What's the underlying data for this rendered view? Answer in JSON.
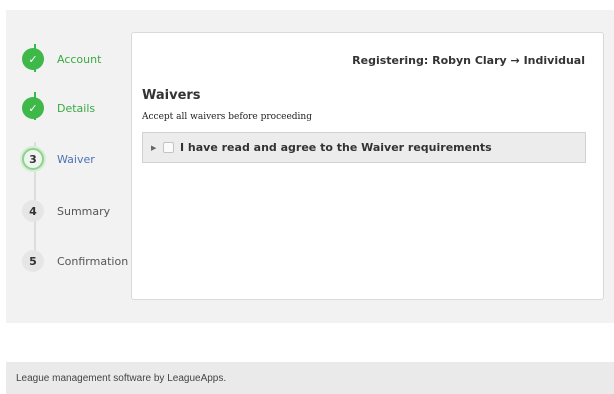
{
  "stepper": {
    "steps": [
      {
        "label": "Account",
        "state": "done",
        "marker": "✓"
      },
      {
        "label": "Details",
        "state": "done",
        "marker": "✓"
      },
      {
        "label": "Waiver",
        "state": "current",
        "marker": "3"
      },
      {
        "label": "Summary",
        "state": "todo",
        "marker": "4"
      },
      {
        "label": "Confirmation",
        "state": "todo",
        "marker": "5"
      }
    ]
  },
  "card": {
    "registering": "Registering: Robyn Clary → Individual",
    "title": "Waivers",
    "subtitle": "Accept all waivers before proceeding",
    "waiver": {
      "arrow": "▶",
      "text": "I have read and agree to the Waiver requirements",
      "checked": false
    }
  },
  "footer": {
    "text": "League management software by LeagueApps."
  },
  "colors": {
    "complete": "#3fb84a",
    "current_label": "#4a73b5",
    "panel_bg": "#f2f2f2"
  },
  "icons": {
    "done": "checkmark-icon",
    "waiver_toggle": "caret-right-icon"
  }
}
